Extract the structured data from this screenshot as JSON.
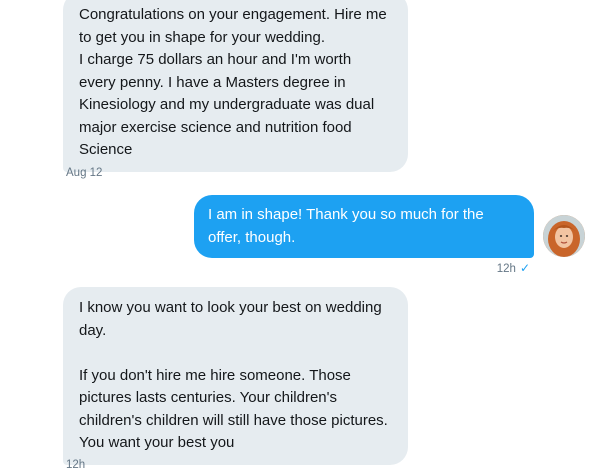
{
  "conversation": {
    "messages": [
      {
        "direction": "received",
        "text": "Congratulations on your engagement. Hire me to get you in shape for your wedding.\nI charge 75 dollars an hour and I'm worth every penny. I have a Masters degree in Kinesiology and my undergraduate was dual major exercise science and nutrition food Science",
        "timestamp": "Aug 12"
      },
      {
        "direction": "sent",
        "text": "I am in shape! Thank you so much for the offer, though.",
        "timestamp": "12h",
        "status_icon": "checkmark-icon"
      },
      {
        "direction": "received",
        "text": "I know you want to look your best on wedding day.\n\nIf you don't hire me hire someone. Those pictures lasts centuries. Your children's children's children will still have those pictures. You want your best you",
        "timestamp": "12h"
      }
    ]
  },
  "colors": {
    "received_bubble": "#e6ecf0",
    "sent_bubble": "#1da1f2",
    "timestamp": "#657786"
  },
  "icons": {
    "read_receipt": "✓"
  }
}
